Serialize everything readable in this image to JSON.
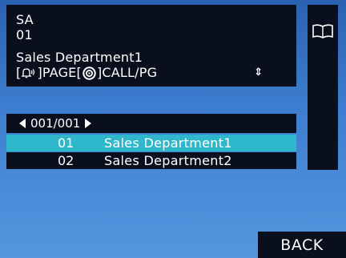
{
  "info": {
    "line1": "SA",
    "line2": "01",
    "line3": "Sales Department1",
    "page_label": "]PAGE[",
    "call_label": "]CALL/PG",
    "bracket_open": "[",
    "scroll_glyph": "⇕"
  },
  "pager": {
    "text": "001/001"
  },
  "list": [
    {
      "number": "01",
      "name": "Sales Department1"
    },
    {
      "number": "02",
      "name": "Sales Department2"
    }
  ],
  "buttons": {
    "back": "BACK"
  },
  "icons": {
    "bell": "bell-icon",
    "target": "target-icon",
    "book": "book-icon"
  },
  "colors": {
    "panel": "#0a0f1e",
    "selected": "#2fb8cc",
    "background": "#3f7fd1"
  }
}
